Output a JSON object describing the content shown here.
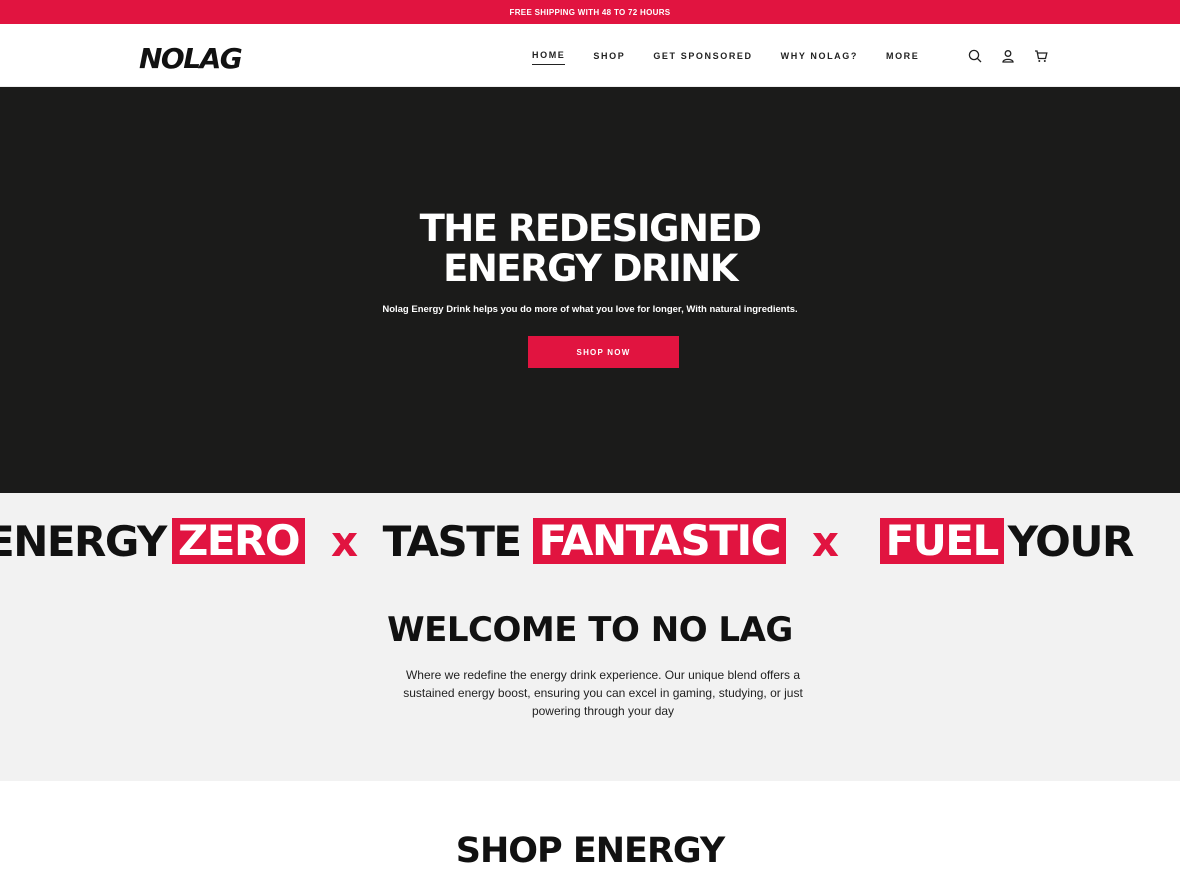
{
  "announcement": "FREE SHIPPING WITH 48 TO 72 HOURS",
  "logo_text": "NOLAG",
  "nav": [
    "HOME",
    "SHOP",
    "GET SPONSORED",
    "WHY NOLAG?",
    "MORE"
  ],
  "icons": [
    "search-icon",
    "account-icon",
    "cart-icon"
  ],
  "hero": {
    "title_line1": "THE REDESIGNED",
    "title_line2": "ENERGY DRINK",
    "subtitle": "Nolag Energy Drink helps you do more of what you love for longer, With natural ingredients.",
    "button": "SHOP NOW"
  },
  "ticker": {
    "w1": "ENERGY",
    "h1": "ZERO",
    "sep": "x",
    "w2": "TASTE",
    "h2": "FANTASTIC",
    "h3": "FUEL",
    "w3": "YOUR"
  },
  "welcome": {
    "title": "WELCOME TO NO LAG",
    "text": "Where we redefine the energy drink experience. Our unique blend offers a sustained energy boost, ensuring you can excel in gaming, studying, or just powering through your day"
  },
  "shop": {
    "title": "SHOP ENERGY"
  },
  "colors": {
    "accent": "#e11440",
    "hero_bg": "#1b1b1a",
    "section_bg": "#f2f2f2"
  }
}
